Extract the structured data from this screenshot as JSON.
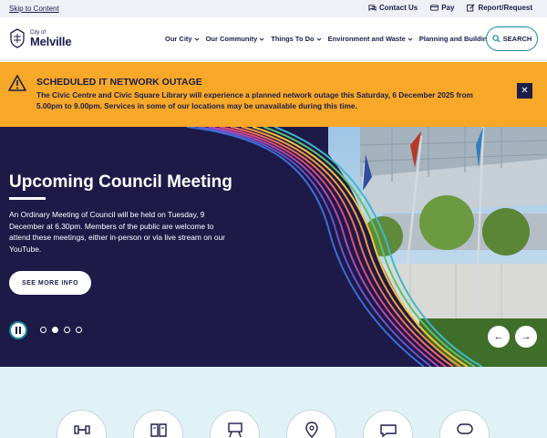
{
  "utility": {
    "skip_label": "Skip to Content",
    "links": [
      {
        "label": "Contact Us",
        "icon": "chat-icon"
      },
      {
        "label": "Pay",
        "icon": "card-icon"
      },
      {
        "label": "Report/Request",
        "icon": "edit-icon"
      }
    ]
  },
  "header": {
    "logo_small": "City of",
    "logo_big": "Melville",
    "nav": [
      {
        "label": "Our City"
      },
      {
        "label": "Our Community"
      },
      {
        "label": "Things To Do"
      },
      {
        "label": "Environment and Waste"
      },
      {
        "label": "Planning and Building"
      }
    ],
    "search_label": "SEARCH"
  },
  "alert": {
    "title": "SCHEDULED IT NETWORK OUTAGE",
    "body": "The Civic Centre and Civic Square Library will experience a planned network outage this Saturday, 6 December 2025 from 5.00pm to 9.00pm. Services in some of our locations may be unavailable during this time.",
    "close_label": "✕"
  },
  "hero": {
    "title": "Upcoming Council Meeting",
    "text": "An Ordinary Meeting of Council will be held on Tuesday, 9 December at 6.30pm. Members of the public are welcome to attend these meetings, either in-person or via live stream on our YouTube.",
    "button_label": "SEE MORE INFO",
    "prev_label": "←",
    "next_label": "→",
    "slide_count": 4,
    "active_slide": 2
  },
  "colors": {
    "navy": "#1d1a48",
    "alert": "#f8a828",
    "teal": "#1b8a9a",
    "quick_bg": "#e0f2f6"
  }
}
